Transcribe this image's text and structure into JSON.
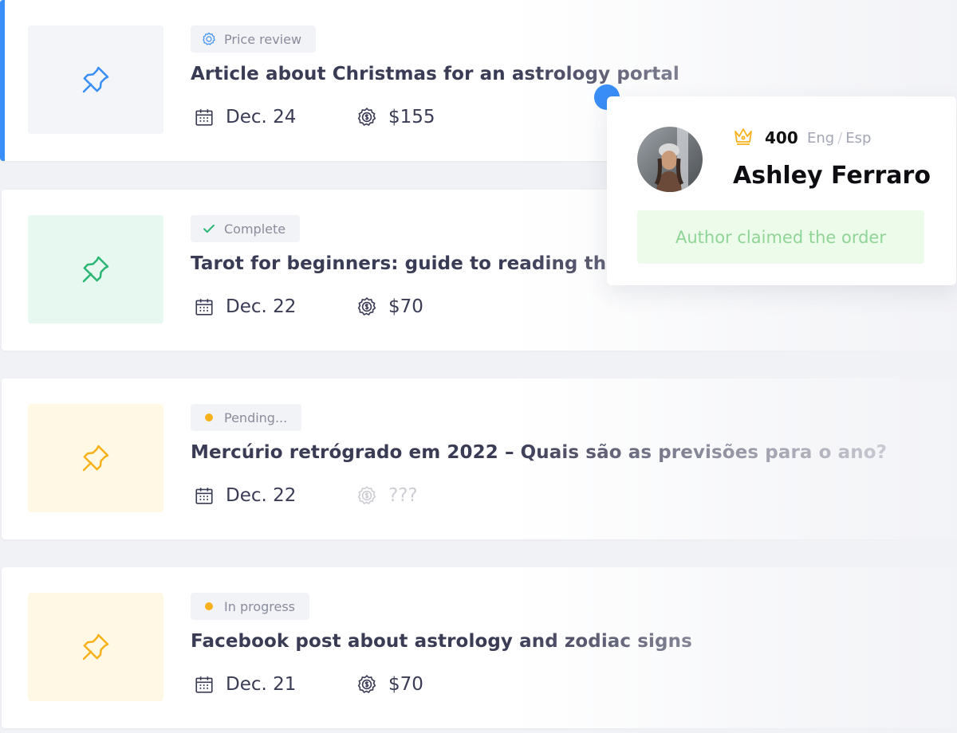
{
  "colors": {
    "accent": "#3a8ef7",
    "complete": "#2bb673",
    "pending": "#f7b21b",
    "thumb_blue": "#f3f5f9",
    "thumb_green": "#e6f8f0",
    "thumb_yellow": "#fff8e5"
  },
  "orders": [
    {
      "status": "Price review",
      "status_icon": "gear-badge-icon",
      "title": "Article about Christmas for an astrology portal",
      "date": "Dec. 24",
      "price": "$155",
      "pin_color": "#3a8ef7",
      "thumb_color": "#f3f5f9"
    },
    {
      "status": "Complete",
      "status_icon": "check-icon",
      "title": "Tarot for beginners: guide to reading the car",
      "date": "Dec. 22",
      "price": "$70",
      "pin_color": "#2bb673",
      "thumb_color": "#e6f8f0"
    },
    {
      "status": "Pending...",
      "status_icon": "dot-icon",
      "title": "Mercúrio retrógrado em 2022 – Quais são as previsões para o ano?",
      "date": "Dec. 22",
      "price": "???",
      "pin_color": "#f7b21b",
      "thumb_color": "#fff8e5"
    },
    {
      "status": "In progress",
      "status_icon": "dot-icon",
      "title": "Facebook post about astrology and zodiac signs",
      "date": "Dec. 21",
      "price": "$70",
      "pin_color": "#f7b21b",
      "thumb_color": "#fff8e5"
    }
  ],
  "author_popup": {
    "rating": "400",
    "lang_from": "Eng",
    "lang_sep": "/",
    "lang_to": "Esp",
    "name": "Ashley Ferraro",
    "claim_text": "Author claimed the order"
  }
}
